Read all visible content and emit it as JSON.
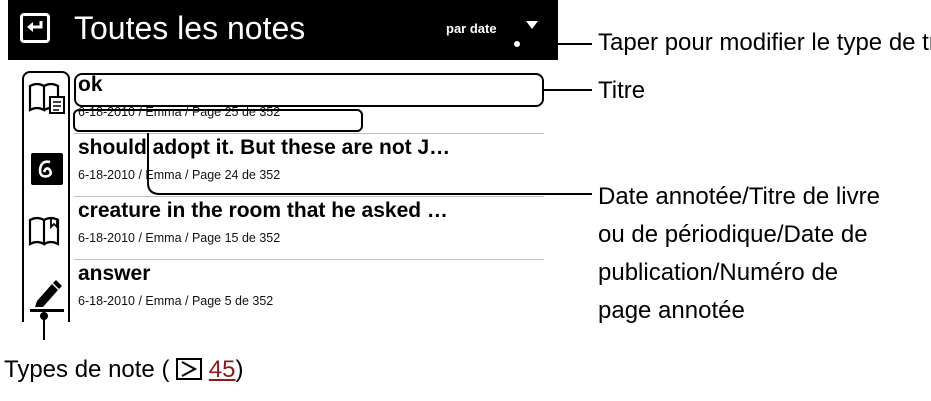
{
  "header": {
    "title": "Toutes les notes",
    "sort_label": "par date"
  },
  "note_types": [
    "book-bookmark-memo-icon",
    "handwriting-icon",
    "book-bookmark-icon",
    "highlighter-icon"
  ],
  "notes": [
    {
      "title": "ok",
      "meta": "6-18-2010 / Emma / Page 25 de 352"
    },
    {
      "title": "should adopt it. But these are not J…",
      "meta": "6-18-2010 / Emma / Page 24 de 352"
    },
    {
      "title": "creature in the room that he asked …",
      "meta": "6-18-2010 / Emma / Page 15 de 352"
    },
    {
      "title": "answer",
      "meta": "6-18-2010 / Emma / Page 5 de 352"
    }
  ],
  "callouts": {
    "sort": "Taper pour modifier le type de tri",
    "title": "Titre",
    "info_lines": [
      "Date annotée/Titre de livre",
      "ou de périodique/Date de",
      "publication/Numéro de",
      "page annotée"
    ],
    "types_prefix": "Types de note (",
    "types_ref": "45",
    "types_suffix": ")"
  },
  "colors": {
    "header_bg": "#000000",
    "link": "#8a1c1c"
  }
}
